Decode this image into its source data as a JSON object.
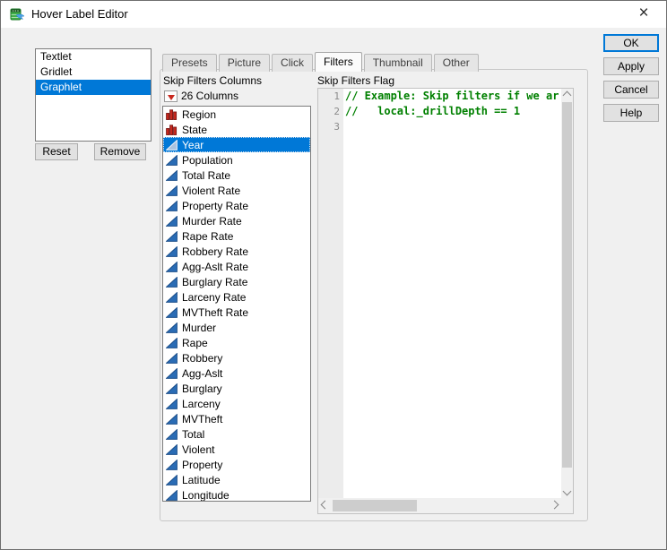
{
  "window": {
    "title": "Hover Label Editor",
    "close_icon": "×"
  },
  "left_panel": {
    "items": [
      {
        "label": "Textlet",
        "selected": false
      },
      {
        "label": "Gridlet",
        "selected": false
      },
      {
        "label": "Graphlet",
        "selected": true
      }
    ],
    "reset_label": "Reset",
    "remove_label": "Remove"
  },
  "tabs": [
    {
      "label": "Presets",
      "selected": false
    },
    {
      "label": "Picture",
      "selected": false
    },
    {
      "label": "Click",
      "selected": false
    },
    {
      "label": "Filters",
      "selected": true
    },
    {
      "label": "Thumbnail",
      "selected": false
    },
    {
      "label": "Other",
      "selected": false
    }
  ],
  "filters_panel": {
    "columns_heading": "Skip Filters Columns",
    "columns_count_label": "26 Columns",
    "columns": [
      {
        "name": "Region",
        "type": "nominal",
        "selected": false
      },
      {
        "name": "State",
        "type": "nominal",
        "selected": false
      },
      {
        "name": "Year",
        "type": "continuous",
        "selected": true
      },
      {
        "name": "Population",
        "type": "continuous",
        "selected": false
      },
      {
        "name": "Total Rate",
        "type": "continuous",
        "selected": false
      },
      {
        "name": "Violent Rate",
        "type": "continuous",
        "selected": false
      },
      {
        "name": "Property Rate",
        "type": "continuous",
        "selected": false
      },
      {
        "name": "Murder Rate",
        "type": "continuous",
        "selected": false
      },
      {
        "name": "Rape Rate",
        "type": "continuous",
        "selected": false
      },
      {
        "name": "Robbery Rate",
        "type": "continuous",
        "selected": false
      },
      {
        "name": "Agg-Aslt Rate",
        "type": "continuous",
        "selected": false
      },
      {
        "name": "Burglary Rate",
        "type": "continuous",
        "selected": false
      },
      {
        "name": "Larceny Rate",
        "type": "continuous",
        "selected": false
      },
      {
        "name": "MVTheft Rate",
        "type": "continuous",
        "selected": false
      },
      {
        "name": "Murder",
        "type": "continuous",
        "selected": false
      },
      {
        "name": "Rape",
        "type": "continuous",
        "selected": false
      },
      {
        "name": "Robbery",
        "type": "continuous",
        "selected": false
      },
      {
        "name": "Agg-Aslt",
        "type": "continuous",
        "selected": false
      },
      {
        "name": "Burglary",
        "type": "continuous",
        "selected": false
      },
      {
        "name": "Larceny",
        "type": "continuous",
        "selected": false
      },
      {
        "name": "MVTheft",
        "type": "continuous",
        "selected": false
      },
      {
        "name": "Total",
        "type": "continuous",
        "selected": false
      },
      {
        "name": "Violent",
        "type": "continuous",
        "selected": false
      },
      {
        "name": "Property",
        "type": "continuous",
        "selected": false
      },
      {
        "name": "Latitude",
        "type": "continuous",
        "selected": false
      },
      {
        "name": "Longitude",
        "type": "continuous",
        "selected": false
      }
    ],
    "flag_heading": "Skip Filters Flag",
    "code_lines": [
      {
        "num": "1",
        "code": "// Example: Skip filters if we ar"
      },
      {
        "num": "2",
        "code": "//   local:_drillDepth == 1"
      },
      {
        "num": "3",
        "code": ""
      }
    ]
  },
  "action_buttons": [
    {
      "label": "OK",
      "default": true
    },
    {
      "label": "Apply",
      "default": false
    },
    {
      "label": "Cancel",
      "default": false
    },
    {
      "label": "Help",
      "default": false
    }
  ],
  "colors": {
    "selection_blue": "#0078d7",
    "comment_green": "#008000",
    "nominal_red": "#c8281e",
    "nominal_red_dark": "#7a1613",
    "continuous_blue": "#2a6cb5",
    "continuous_blue_dark": "#1c4f8a",
    "dialog_bg": "#f0f0f0"
  }
}
